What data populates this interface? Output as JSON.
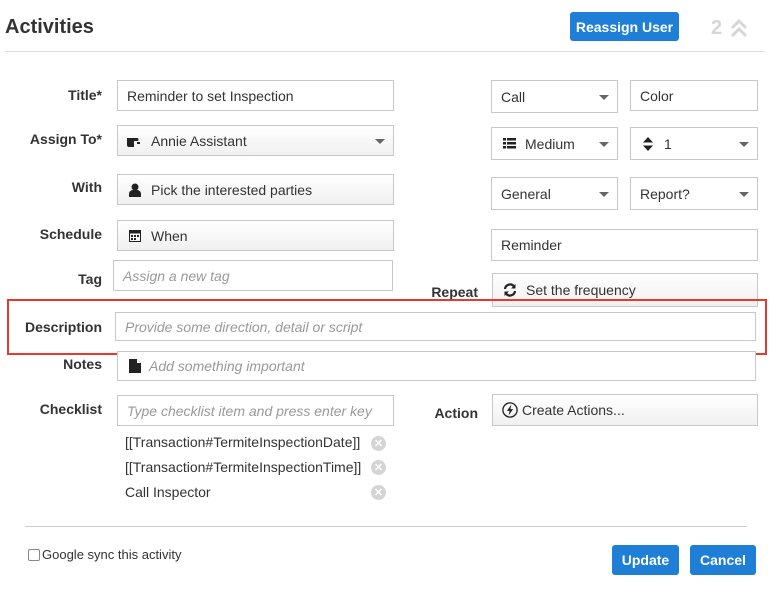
{
  "header": {
    "title": "Activities",
    "reassign_label": "Reassign User",
    "count": "2"
  },
  "form": {
    "title_label": "Title*",
    "title_value": "Reminder to set Inspection",
    "assign_label": "Assign To*",
    "assign_value": "Annie Assistant",
    "with_label": "With",
    "with_value": "Pick the interested parties",
    "schedule_label": "Schedule",
    "schedule_value": "When",
    "tag_label": "Tag",
    "tag_placeholder": "Assign a new tag",
    "repeat_label": "Repeat",
    "repeat_value": "Set the frequency",
    "description_label": "Description",
    "description_placeholder": "Provide some direction, detail or script",
    "notes_label": "Notes",
    "notes_placeholder": "Add something important",
    "checklist_label": "Checklist",
    "checklist_placeholder": "Type checklist item and press enter key",
    "checklist_items": [
      "[[Transaction#TermiteInspectionDate]]",
      "[[Transaction#TermiteInspectionTime]]",
      "Call Inspector"
    ],
    "action_label": "Action",
    "action_value": "Create Actions..."
  },
  "right": {
    "type_value": "Call",
    "color_value": "Color",
    "priority_value": "Medium",
    "order_value": "1",
    "category_value": "General",
    "report_value": "Report?",
    "reminder_value": "Reminder"
  },
  "footer": {
    "google_sync_label": "Google sync this activity",
    "update_label": "Update",
    "cancel_label": "Cancel"
  },
  "colors": {
    "accent": "#1f7fd6",
    "highlight": "#e8392b"
  },
  "icons": [
    "double-chevron-up-icon",
    "pointing-hand-icon",
    "person-icon",
    "calendar-icon",
    "refresh-icon",
    "document-icon",
    "lightning-icon",
    "list-icon",
    "sort-arrows-icon",
    "close-circle-icon"
  ]
}
